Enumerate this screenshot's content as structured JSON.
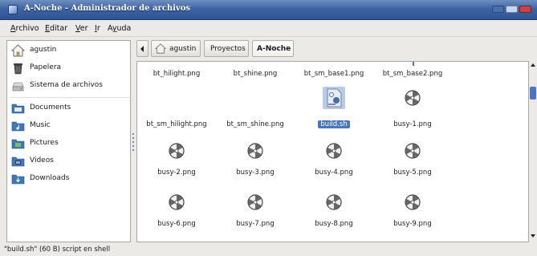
{
  "window": {
    "title": "A-Noche - Administrador de archivos"
  },
  "menubar": {
    "items": [
      {
        "label": "Archivo",
        "mnemonic": "A",
        "rest": "rchivo"
      },
      {
        "label": "Editar",
        "mnemonic": "E",
        "rest": "ditar"
      },
      {
        "label": "Ver",
        "mnemonic": "V",
        "rest": "er"
      },
      {
        "label": "Ir",
        "mnemonic": "I",
        "rest": "r"
      },
      {
        "label": "Ayuda",
        "mnemonic": "y",
        "pre": "A",
        "rest": "uda"
      }
    ]
  },
  "sidebar": {
    "items": [
      {
        "label": "agustin",
        "icon": "home-icon"
      },
      {
        "label": "Papelera",
        "icon": "trash-icon"
      },
      {
        "label": "Sistema de archivos",
        "icon": "drive-icon"
      },
      {
        "label": "Documents",
        "icon": "folder-icon"
      },
      {
        "label": "Music",
        "icon": "folder-icon"
      },
      {
        "label": "Pictures",
        "icon": "folder-icon"
      },
      {
        "label": "Videos",
        "icon": "folder-icon"
      },
      {
        "label": "Downloads",
        "icon": "folder-icon"
      }
    ]
  },
  "pathbar": {
    "home": "agustin",
    "crumbs": [
      "Proyectos",
      "A-Noche"
    ]
  },
  "files": [
    {
      "name": "bt_hilight.png",
      "icon": "none"
    },
    {
      "name": "bt_shine.png",
      "icon": "none"
    },
    {
      "name": "bt_sm_base1.png",
      "icon": "none"
    },
    {
      "name": "bt_sm_base2.png",
      "icon": "none"
    },
    {
      "name": "bt_sm_hilight.png",
      "icon": "none"
    },
    {
      "name": "bt_sm_shine.png",
      "icon": "none"
    },
    {
      "name": "build.sh",
      "icon": "script-icon",
      "selected": true
    },
    {
      "name": "busy-1.png",
      "icon": "busy-image-icon"
    },
    {
      "name": "busy-2.png",
      "icon": "busy-image-icon"
    },
    {
      "name": "busy-3.png",
      "icon": "busy-image-icon"
    },
    {
      "name": "busy-4.png",
      "icon": "busy-image-icon"
    },
    {
      "name": "busy-5.png",
      "icon": "busy-image-icon"
    },
    {
      "name": "busy-6.png",
      "icon": "busy-image-icon"
    },
    {
      "name": "busy-7.png",
      "icon": "busy-image-icon"
    },
    {
      "name": "busy-8.png",
      "icon": "busy-image-icon"
    },
    {
      "name": "busy-9.png",
      "icon": "busy-image-icon"
    }
  ],
  "status": {
    "text": "\"build.sh\" (60 B) script en shell"
  },
  "colors": {
    "titlebar": "#3f64a5",
    "selection": "#4a76c0",
    "window_bg": "#eceae6"
  }
}
